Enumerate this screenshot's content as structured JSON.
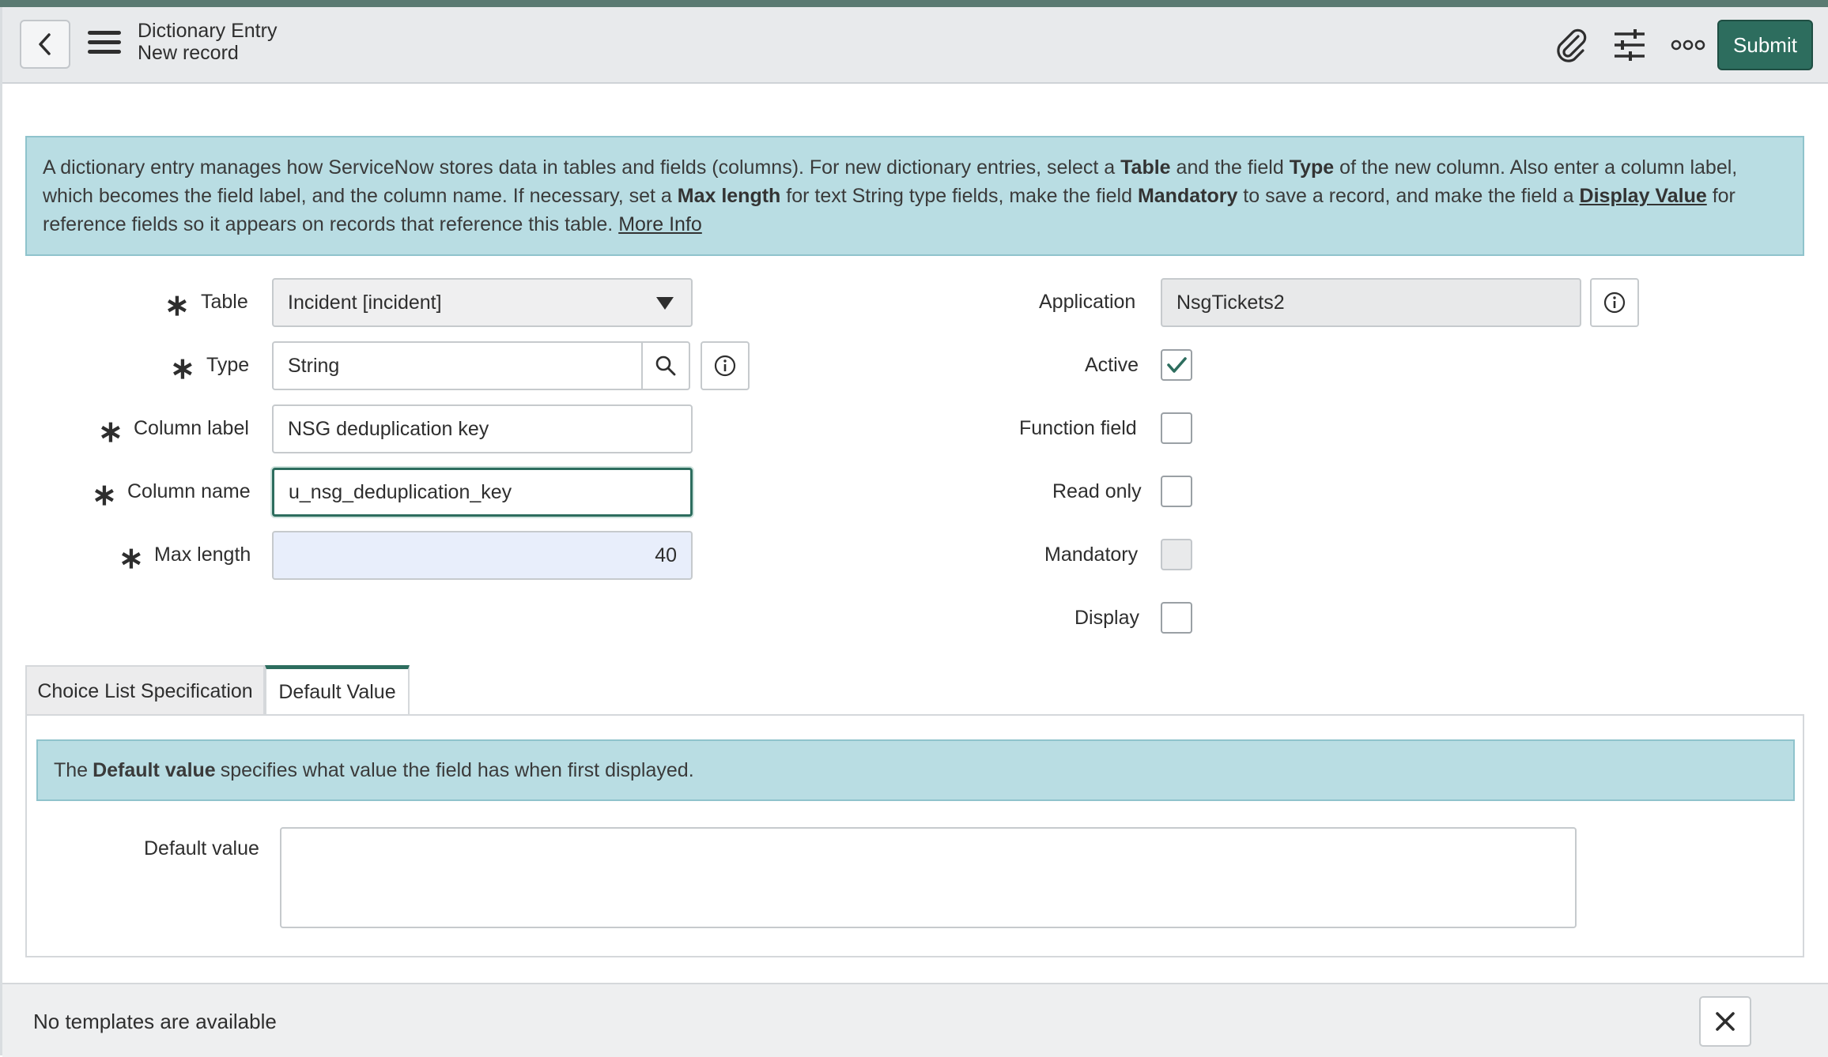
{
  "header": {
    "title": "Dictionary Entry",
    "subtitle": "New record",
    "submit_label": "Submit"
  },
  "info": {
    "p1": "A dictionary entry manages how ServiceNow stores data in tables and fields (columns). For new dictionary entries, select a ",
    "b_table": "Table",
    "p2": " and the field ",
    "b_type": "Type",
    "p3": " of the new column. Also enter a column label, which becomes the field label, and the column name. If necessary, set a ",
    "b_maxlen": "Max length",
    "p4": " for text String type fields, make the field ",
    "b_mandatory": "Mandatory",
    "p5": " to save a record, and make the field a ",
    "link_display": "Display Value",
    "p6": " for reference fields so it appears on records that reference this table. ",
    "link_more": "More Info"
  },
  "form": {
    "table_label": "Table",
    "table_value": "Incident [incident]",
    "type_label": "Type",
    "type_value": "String",
    "column_label_label": "Column label",
    "column_label_value": "NSG deduplication key",
    "column_name_label": "Column name",
    "column_name_value": "u_nsg_deduplication_key",
    "max_length_label": "Max length",
    "max_length_value": "40",
    "application_label": "Application",
    "application_value": "NsgTickets2",
    "active_label": "Active",
    "function_field_label": "Function field",
    "read_only_label": "Read only",
    "mandatory_label": "Mandatory",
    "display_label": "Display"
  },
  "checkboxes": {
    "active": true,
    "function_field": false,
    "read_only": false,
    "mandatory": false,
    "display": false
  },
  "tabs": [
    {
      "label": "Choice List Specification",
      "active": false
    },
    {
      "label": "Default Value",
      "active": true
    }
  ],
  "default_panel": {
    "info_pre": "The ",
    "info_bold": "Default value",
    "info_post": " specifies what value the field has when first displayed.",
    "default_value_label": "Default value",
    "default_value": ""
  },
  "footer": {
    "text": "No templates are available"
  },
  "colors": {
    "accent": "#2d6d5e",
    "info_bg": "#b9dde3"
  }
}
